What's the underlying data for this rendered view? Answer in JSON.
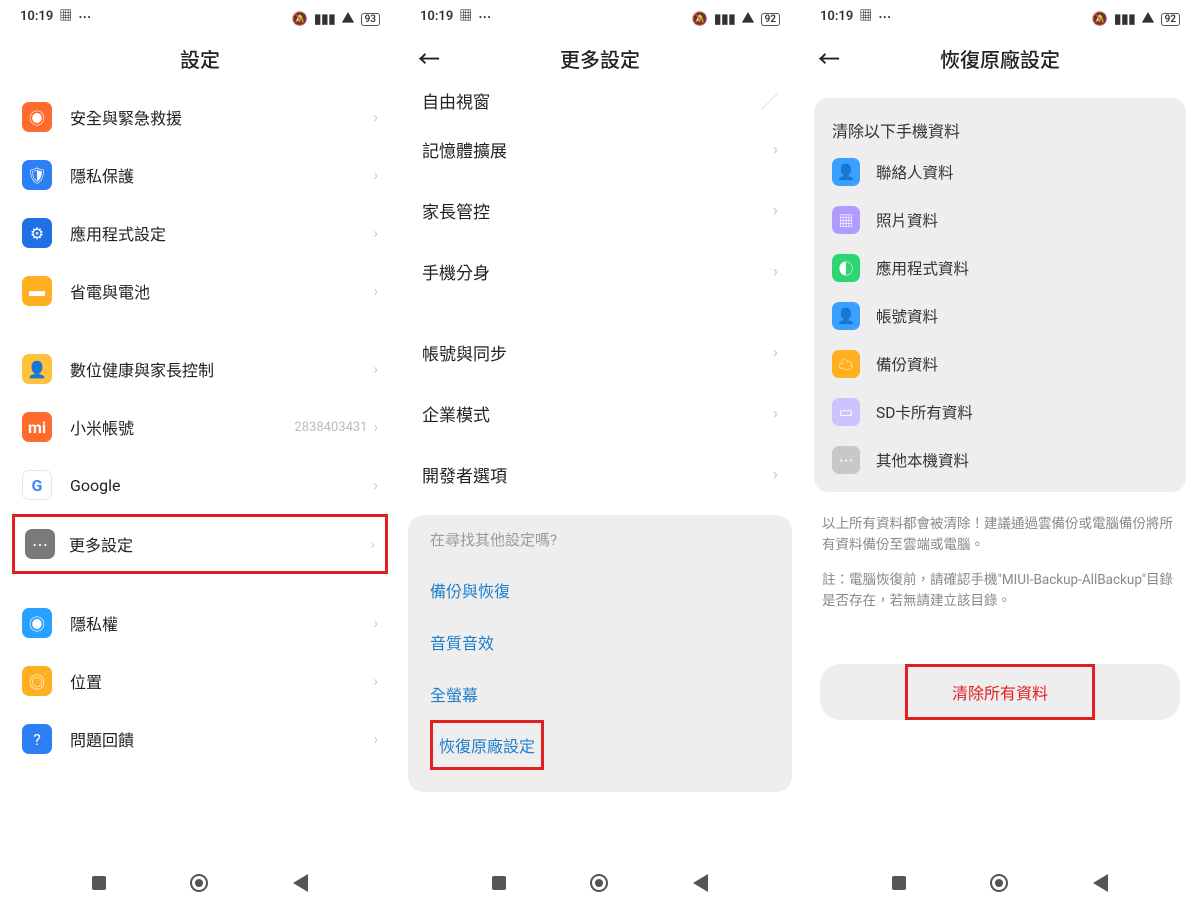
{
  "status": {
    "time": "10:19",
    "battery1": "93",
    "battery2": "92",
    "battery3": "92"
  },
  "panel1": {
    "title": "設定",
    "items": [
      {
        "label": "安全與緊急救援"
      },
      {
        "label": "隱私保護"
      },
      {
        "label": "應用程式設定"
      },
      {
        "label": "省電與電池"
      },
      {
        "label": "數位健康與家長控制"
      },
      {
        "label": "小米帳號",
        "extra": "2838403431"
      },
      {
        "label": "Google"
      },
      {
        "label": "更多設定"
      },
      {
        "label": "隱私權"
      },
      {
        "label": "位置"
      },
      {
        "label": "問題回饋"
      }
    ]
  },
  "panel2": {
    "title": "更多設定",
    "cutoff": "自由視窗",
    "items": [
      {
        "label": "記憶體擴展"
      },
      {
        "label": "家長管控"
      },
      {
        "label": "手機分身"
      },
      {
        "label": "帳號與同步"
      },
      {
        "label": "企業模式"
      },
      {
        "label": "開發者選項"
      }
    ],
    "search_q": "在尋找其他設定嗎?",
    "links": [
      {
        "label": "備份與恢復"
      },
      {
        "label": "音質音效"
      },
      {
        "label": "全螢幕"
      },
      {
        "label": "恢復原廠設定"
      }
    ]
  },
  "panel3": {
    "title": "恢復原廠設定",
    "card_title": "清除以下手機資料",
    "data_items": [
      {
        "label": "聯絡人資料"
      },
      {
        "label": "照片資料"
      },
      {
        "label": "應用程式資料"
      },
      {
        "label": "帳號資料"
      },
      {
        "label": "備份資料"
      },
      {
        "label": "SD卡所有資料"
      },
      {
        "label": "其他本機資料"
      }
    ],
    "info1": "以上所有資料都會被清除！建議通過雲備份或電腦備份將所有資料備份至雲端或電腦。",
    "info2": "註：電腦恢復前，請確認手機\"MIUI-Backup-AllBackup\"目錄是否存在，若無請建立該目錄。",
    "erase_label": "清除所有資料"
  }
}
